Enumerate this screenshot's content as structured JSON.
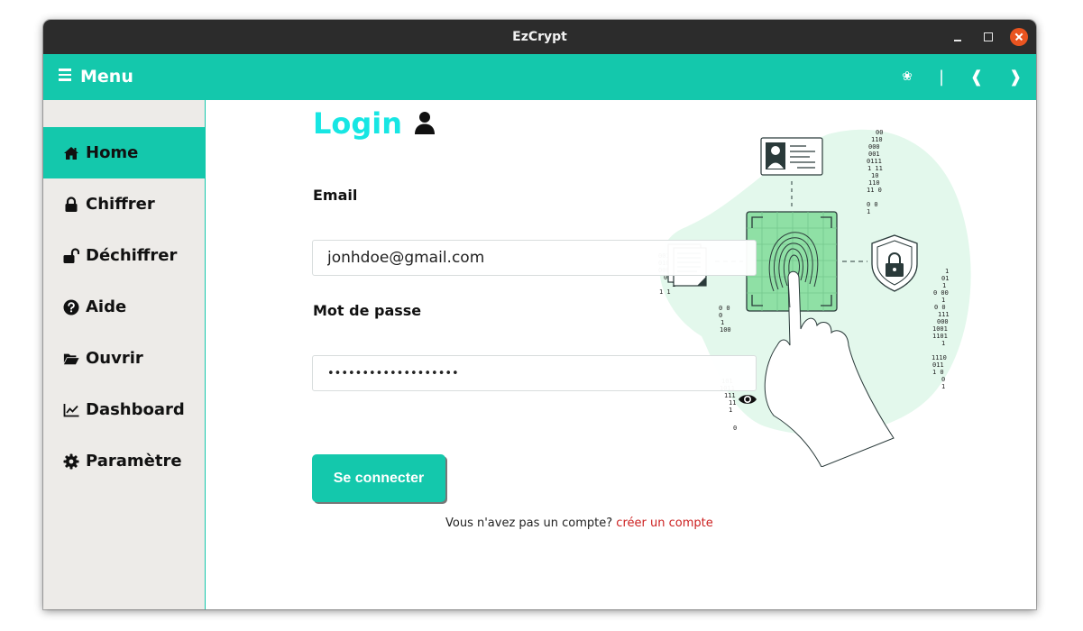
{
  "window": {
    "title": "EzCrypt"
  },
  "menubar": {
    "menu_label": "Menu",
    "controls": [
      "❀",
      "|",
      "❰",
      "❱"
    ]
  },
  "sidebar": {
    "items": [
      {
        "label": "Home",
        "icon": "home-icon",
        "active": true
      },
      {
        "label": "Chiffrer",
        "icon": "lock-icon",
        "active": false
      },
      {
        "label": "Déchiffrer",
        "icon": "unlock-icon",
        "active": false
      },
      {
        "label": "Aide",
        "icon": "question-circle-icon",
        "active": false
      },
      {
        "label": "Ouvrir",
        "icon": "folder-open-icon",
        "active": false
      },
      {
        "label": "Dashboard",
        "icon": "line-chart-icon",
        "active": false
      },
      {
        "label": "Paramètre",
        "icon": "gear-icon",
        "active": false
      }
    ]
  },
  "login": {
    "title": "Login",
    "title_icon": "user-icon",
    "email_label": "Email",
    "email_value": "jonhdoe@gmail.com",
    "password_label": "Mot de passe",
    "password_value": "•••••••••••••••••••",
    "password_toggle_icon": "eye-icon",
    "submit_label": "Se connecter",
    "signup_prompt": "Vous n'avez pas un compte?",
    "signup_link": "créer un compte"
  },
  "colors": {
    "accent": "#14c8ac",
    "title": "#17e6e3",
    "link": "#cc1f1f",
    "titlebar": "#2c2c2c",
    "sidebar_bg": "#edebe8"
  }
}
